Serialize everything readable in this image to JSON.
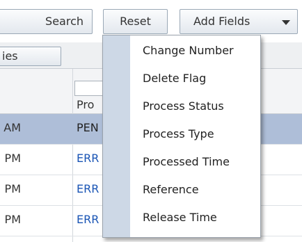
{
  "toolbar": {
    "search_label": "Search",
    "reset_label": "Reset",
    "add_fields_label": "Add Fields"
  },
  "tab_strip": {
    "tab_label": "ies"
  },
  "grid": {
    "column_header": "Pro",
    "rows": [
      {
        "time": "AM",
        "status": "PEN",
        "selected": true
      },
      {
        "time": "PM",
        "status": "ERR",
        "selected": false
      },
      {
        "time": "PM",
        "status": "ERR",
        "selected": false
      },
      {
        "time": "PM",
        "status": "ERR",
        "selected": false
      }
    ]
  },
  "add_fields_menu": {
    "items": [
      "Change Number",
      "Delete Flag",
      "Process Status",
      "Process Type",
      "Processed Time",
      "Reference",
      "Release Time"
    ]
  },
  "colors": {
    "selected_row": "#aebed8",
    "link_text": "#1a55b5",
    "menu_gutter": "#cdd8e6"
  }
}
